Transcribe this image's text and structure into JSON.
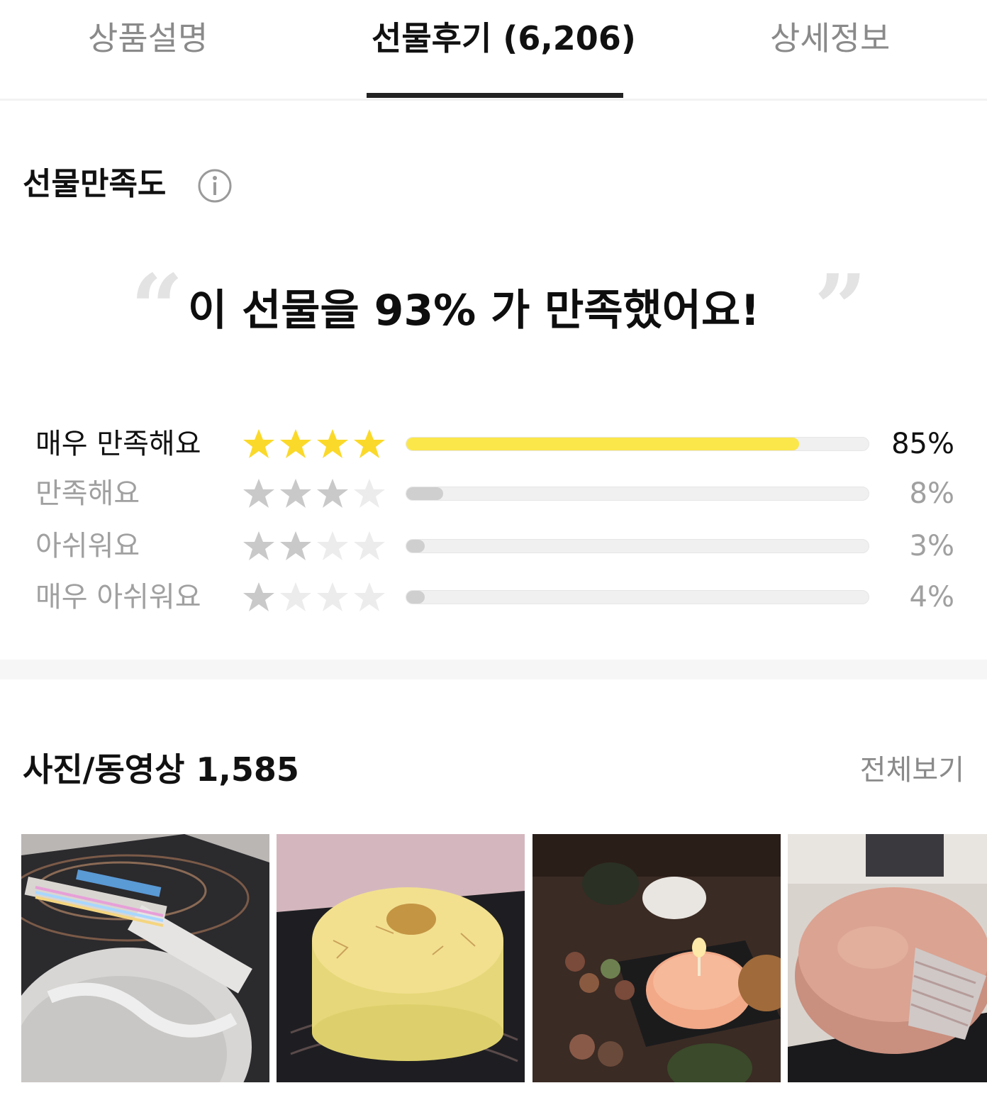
{
  "tabs": [
    {
      "label": "상품설명",
      "active": false
    },
    {
      "label": "선물후기 (6,206)",
      "active": true
    },
    {
      "label": "상세정보",
      "active": false
    }
  ],
  "satisfaction": {
    "title": "선물만족도",
    "headline": {
      "prefix": "이 선물을 ",
      "highlight": "93% 가 만족했어요!"
    },
    "open_quote": "“",
    "close_quote": "”",
    "ratings": [
      {
        "label": "매우 만족해요",
        "stars": 4,
        "percent": "85%",
        "fraction": 0.85
      },
      {
        "label": "만족해요",
        "stars": 3,
        "percent": "8%",
        "fraction": 0.08
      },
      {
        "label": "아쉬워요",
        "stars": 2,
        "percent": "3%",
        "fraction": 0.03
      },
      {
        "label": "매우 아쉬워요",
        "stars": 1,
        "percent": "4%",
        "fraction": 0.04
      }
    ],
    "colors": {
      "highlight": "#ffe94a",
      "star_active": "#fbd92a",
      "star_gray": "#c9c9c9",
      "star_empty": "#ececec"
    }
  },
  "photos": {
    "title": "사진/동영상 1,585",
    "view_all": "전체보기",
    "items": [
      {
        "icon": "photo-crepe-cake-box"
      },
      {
        "icon": "photo-crepe-cake"
      },
      {
        "icon": "photo-birthday-table"
      },
      {
        "icon": "photo-sliced-cake"
      }
    ]
  }
}
